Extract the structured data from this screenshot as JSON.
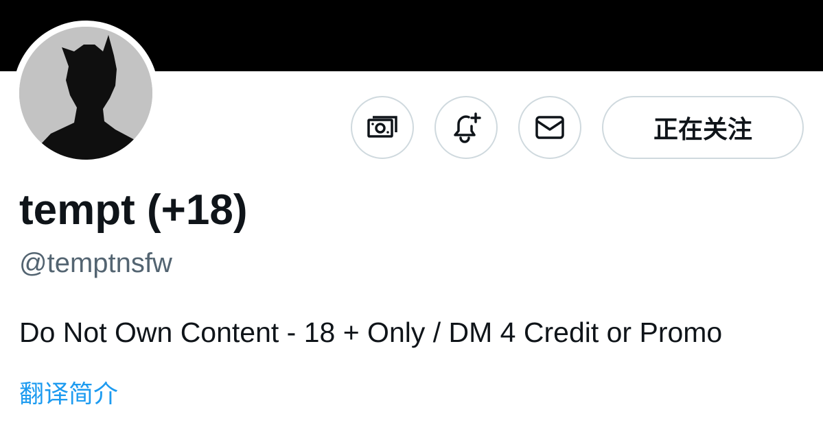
{
  "profile": {
    "display_name": "tempt (+18)",
    "handle": "@temptnsfw",
    "bio": "Do Not Own Content - 18 + Only / DM 4 Credit or Promo",
    "translate_bio_label": "翻译简介"
  },
  "actions": {
    "tip_icon": "money-icon",
    "notify_icon": "bell-plus-icon",
    "message_icon": "envelope-icon",
    "follow_label": "正在关注"
  },
  "colors": {
    "banner": "#000000",
    "text_primary": "#0f1419",
    "text_secondary": "#536471",
    "link": "#1d9bf0",
    "button_border": "#cfd9de"
  }
}
